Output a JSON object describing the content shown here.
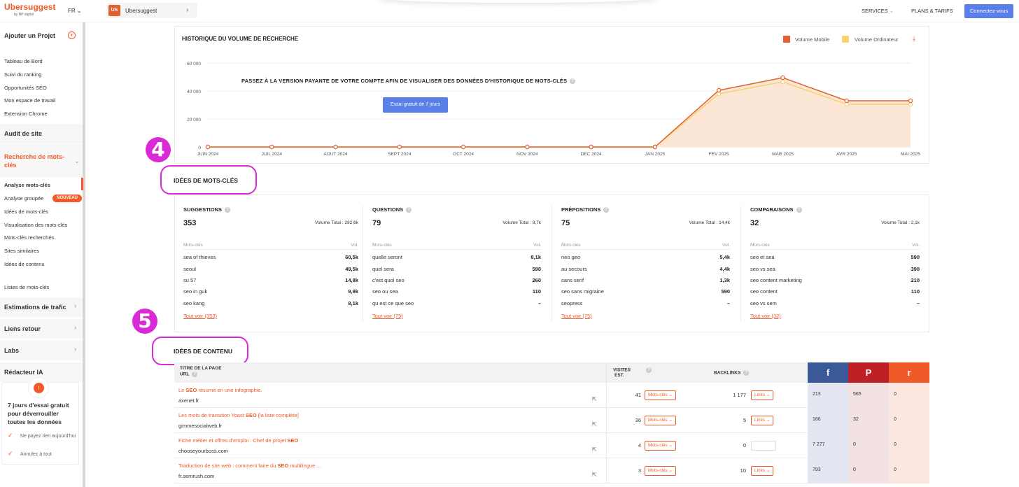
{
  "header": {
    "logo": "Ubersuggest",
    "logo_sub": "by NP digital",
    "lang": "FR",
    "project_badge": "US",
    "project_name": "Ubersuggest",
    "nav_services": "SERVICES",
    "nav_plans": "PLANS & TARIFS",
    "connect_label": "Connectez-vous",
    "colors": {
      "brand": "#f05a28",
      "primary": "#5b7fe8"
    }
  },
  "sidebar": {
    "add_project": "Ajouter un Projet",
    "links": [
      "Tableau de Bord",
      "Suivi du ranking",
      "Opportunités SEO",
      "Mon espace de travail",
      "Extension Chrome"
    ],
    "audit": "Audit de site",
    "keyword_research": "Recherche de mots-clés",
    "keyword_items": [
      "Analyse mots-clés",
      "Analyse groupée",
      "Idées de mots-clés",
      "Visualisation des mots-clés",
      "Mots-clés recherchés",
      "Sites similaires",
      "Idées de contenu"
    ],
    "new_badge": "NOUVEAU",
    "lists": "Listes de mots-clés",
    "sections": [
      "Estimations de trafic",
      "Liens retour",
      "Labs",
      "Rédacteur IA"
    ],
    "trial_title": "7 jours d'essai gratuit pour déverrouiller toutes les données",
    "trial_checks": [
      "Ne payez rien aujourd'hui",
      "Annulez à tout"
    ]
  },
  "history": {
    "title": "HISTORIQUE DU VOLUME DE RECHERCHE",
    "legend_mobile": "Volume Mobile",
    "legend_desktop": "Volume Ordinateur",
    "upsell": "PASSEZ À LA VERSION PAYANTE DE VOTRE COMPTE AFIN DE VISUALISER DES DONNÉES D'HISTORIQUE DE MOTS-CLÉS",
    "trial_button": "Essai gratuit de 7 jours"
  },
  "chart_data": {
    "type": "area",
    "categories": [
      "JUIN 2024",
      "JUIL 2024",
      "AOUT 2024",
      "SEPT 2024",
      "OCT 2024",
      "NOV 2024",
      "DEC 2024",
      "JAN 2025",
      "FEV 2025",
      "MAR 2025",
      "AVR 2025",
      "MAI 2025"
    ],
    "y_ticks": [
      "0",
      "20 000",
      "40 000",
      "60 000"
    ],
    "ylim": [
      0,
      60000
    ],
    "series": [
      {
        "name": "Volume Mobile",
        "color": "#e0612f",
        "values": [
          0,
          0,
          0,
          0,
          0,
          0,
          0,
          0,
          40500,
          49500,
          33000,
          33000
        ]
      },
      {
        "name": "Volume Ordinateur",
        "color": "#f7d36e",
        "values": [
          0,
          0,
          0,
          0,
          0,
          0,
          0,
          0,
          38000,
          46500,
          30500,
          30500
        ]
      }
    ],
    "grid": true,
    "legend": "top-right"
  },
  "keyword_ideas": {
    "heading": "IDÉES DE MOTS-CLÉS",
    "step": "4",
    "columns": [
      {
        "title": "SUGGESTIONS",
        "count": "353",
        "volume": "Volume Total : 282,6k",
        "head_l": "Mots-clés",
        "head_r": "Vol.",
        "rows": [
          [
            "sea of thieves",
            "60,5k"
          ],
          [
            "seoul",
            "49,5k"
          ],
          [
            "su 57",
            "14,8k"
          ],
          [
            "seo in guk",
            "9,9k"
          ],
          [
            "seo kang",
            "8,1k"
          ]
        ],
        "all": "Tout voir (353)"
      },
      {
        "title": "QUESTIONS",
        "count": "79",
        "volume": "Volume Total : 9,7k",
        "head_l": "Mots-clés",
        "head_r": "Vol.",
        "rows": [
          [
            "quelle seront",
            "8,1k"
          ],
          [
            "quel sera",
            "590"
          ],
          [
            "c'est quoi seo",
            "260"
          ],
          [
            "seo ou sea",
            "110"
          ],
          [
            "qu est ce que seo",
            "–"
          ]
        ],
        "all": "Tout voir (79)"
      },
      {
        "title": "PRÉPOSITIONS",
        "count": "75",
        "volume": "Volume Total : 14,4k",
        "head_l": "Mots-clés",
        "head_r": "Vol.",
        "rows": [
          [
            "neo geo",
            "5,4k"
          ],
          [
            "au secours",
            "4,4k"
          ],
          [
            "sans serif",
            "1,3k"
          ],
          [
            "seo sans migraine",
            "590"
          ],
          [
            "seopress",
            "–"
          ]
        ],
        "all": "Tout voir (75)"
      },
      {
        "title": "COMPARAISONS",
        "count": "32",
        "volume": "Volume Total : 2,1k",
        "head_l": "Mots-clés",
        "head_r": "Vol.",
        "rows": [
          [
            "seo et sea",
            "590"
          ],
          [
            "seo vs sea",
            "390"
          ],
          [
            "seo content marketing",
            "210"
          ],
          [
            "seo content",
            "110"
          ],
          [
            "seo vs sem",
            "–"
          ]
        ],
        "all": "Tout voir (32)"
      }
    ]
  },
  "content_ideas": {
    "heading": "IDÉES DE CONTENU",
    "step": "5",
    "col_title": "TITRE DE LA PAGE",
    "col_url": "URL",
    "col_visits_1": "VISITES",
    "col_visits_2": "EST.",
    "col_backlinks": "BACKLINKS",
    "social": [
      {
        "glyph": "f",
        "color": "#3b5998"
      },
      {
        "glyph": "P",
        "color": "#bd2126"
      },
      {
        "glyph": "r",
        "color": "#f05a28"
      }
    ],
    "kw_btn": "Mots-clés",
    "links_btn": "Links",
    "rows": [
      {
        "t1": "Le ",
        "t2": "SEO",
        "t3": " résumé en une infographie.",
        "url": "axenet.fr",
        "visits": "41",
        "backlinks": "1 177",
        "links_enabled": true,
        "fb": "213",
        "pin": "565",
        "red": "0"
      },
      {
        "t1": "Les mots de transition Yoast ",
        "t2": "SEO",
        "t3": " [la liste complète]",
        "url": "gimmesocialweb.fr",
        "visits": "36",
        "backlinks": "5",
        "links_enabled": true,
        "fb": "166",
        "pin": "32",
        "red": "0"
      },
      {
        "t1": "Fiche métier et offres d'emploi : Chef de projet ",
        "t2": "SEO",
        "t3": "",
        "url": "chooseyourboss.com",
        "visits": "4",
        "backlinks": "0",
        "links_enabled": false,
        "fb": "7 277",
        "pin": "0",
        "red": "0"
      },
      {
        "t1": "Traduction de site web : comment faire du ",
        "t2": "SEO",
        "t3": " multilingue ...",
        "url": "fr.semrush.com",
        "visits": "3",
        "backlinks": "10",
        "links_enabled": true,
        "fb": "793",
        "pin": "0",
        "red": "0"
      }
    ]
  }
}
